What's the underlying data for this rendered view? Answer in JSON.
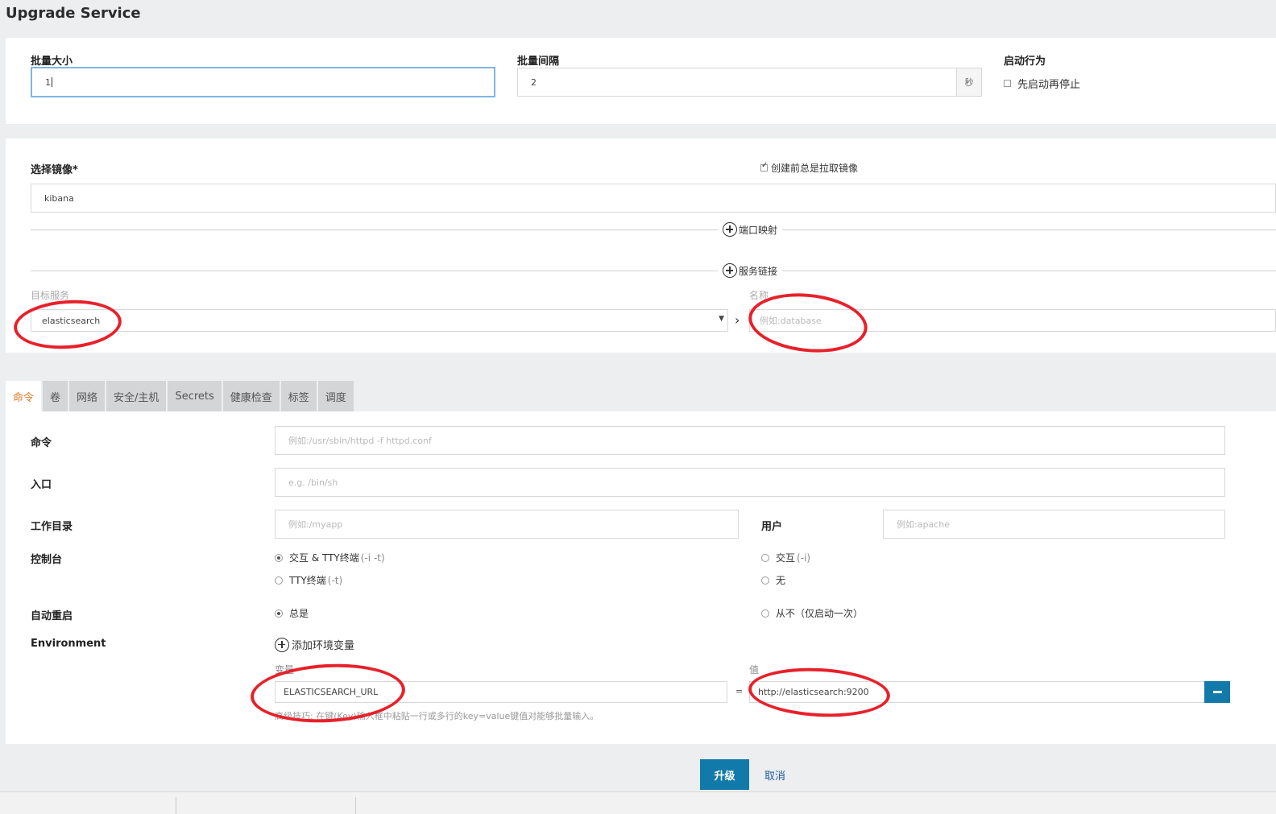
{
  "page": {
    "title": "Upgrade Service"
  },
  "batch": {
    "size_label": "批量大小",
    "size_value": "1",
    "interval_label": "批量间隔",
    "interval_value": "2",
    "interval_unit": "秒",
    "start_label": "启动行为",
    "start_option": "先启动再停止"
  },
  "image": {
    "label": "选择镜像*",
    "value": "kibana",
    "always_pull_label": "创建前总是拉取镜像",
    "port_mapping": "端口映射",
    "service_links": "服务链接",
    "target_label": "目标服务",
    "target_value": "elasticsearch",
    "alias_label": "名称",
    "alias_placeholder": "例如:database"
  },
  "tabs": [
    "命令",
    "卷",
    "网络",
    "安全/主机",
    "Secrets",
    "健康检查",
    "标签",
    "调度"
  ],
  "command": {
    "cmd_label": "命令",
    "cmd_placeholder": "例如:/usr/sbin/httpd -f httpd.conf",
    "entry_label": "入口",
    "entry_placeholder": "e.g. /bin/sh",
    "workdir_label": "工作目录",
    "workdir_placeholder": "例如:/myapp",
    "user_label": "用户",
    "user_placeholder": "例如:apache",
    "console_label": "控制台",
    "console_opt1": "交互 & TTY终端",
    "console_opt1_sub": "(-i -t)",
    "console_opt2": "TTY终端",
    "console_opt2_sub": "(-t)",
    "console_opt3": "交互",
    "console_opt3_sub": "(-i)",
    "console_opt4": "无",
    "restart_label": "自动重启",
    "restart_opt1": "总是",
    "restart_opt2": "从不（仅启动一次）",
    "env_label": "Environment",
    "env_add": "添加环境变量",
    "env_key_label": "变量",
    "env_value_label": "值",
    "env_key": "ELASTICSEARCH_URL",
    "env_eq": "=",
    "env_value": "http://elasticsearch:9200",
    "env_hint": "高级技巧: 在键(Key)输入框中粘贴一行或多行的key=value键值对能够批量输入。"
  },
  "actions": {
    "upgrade": "升级",
    "cancel": "取消"
  },
  "colors": {
    "primary": "#117aaa",
    "accent_tab": "#e07a2b",
    "annotation": "#e8202a"
  }
}
